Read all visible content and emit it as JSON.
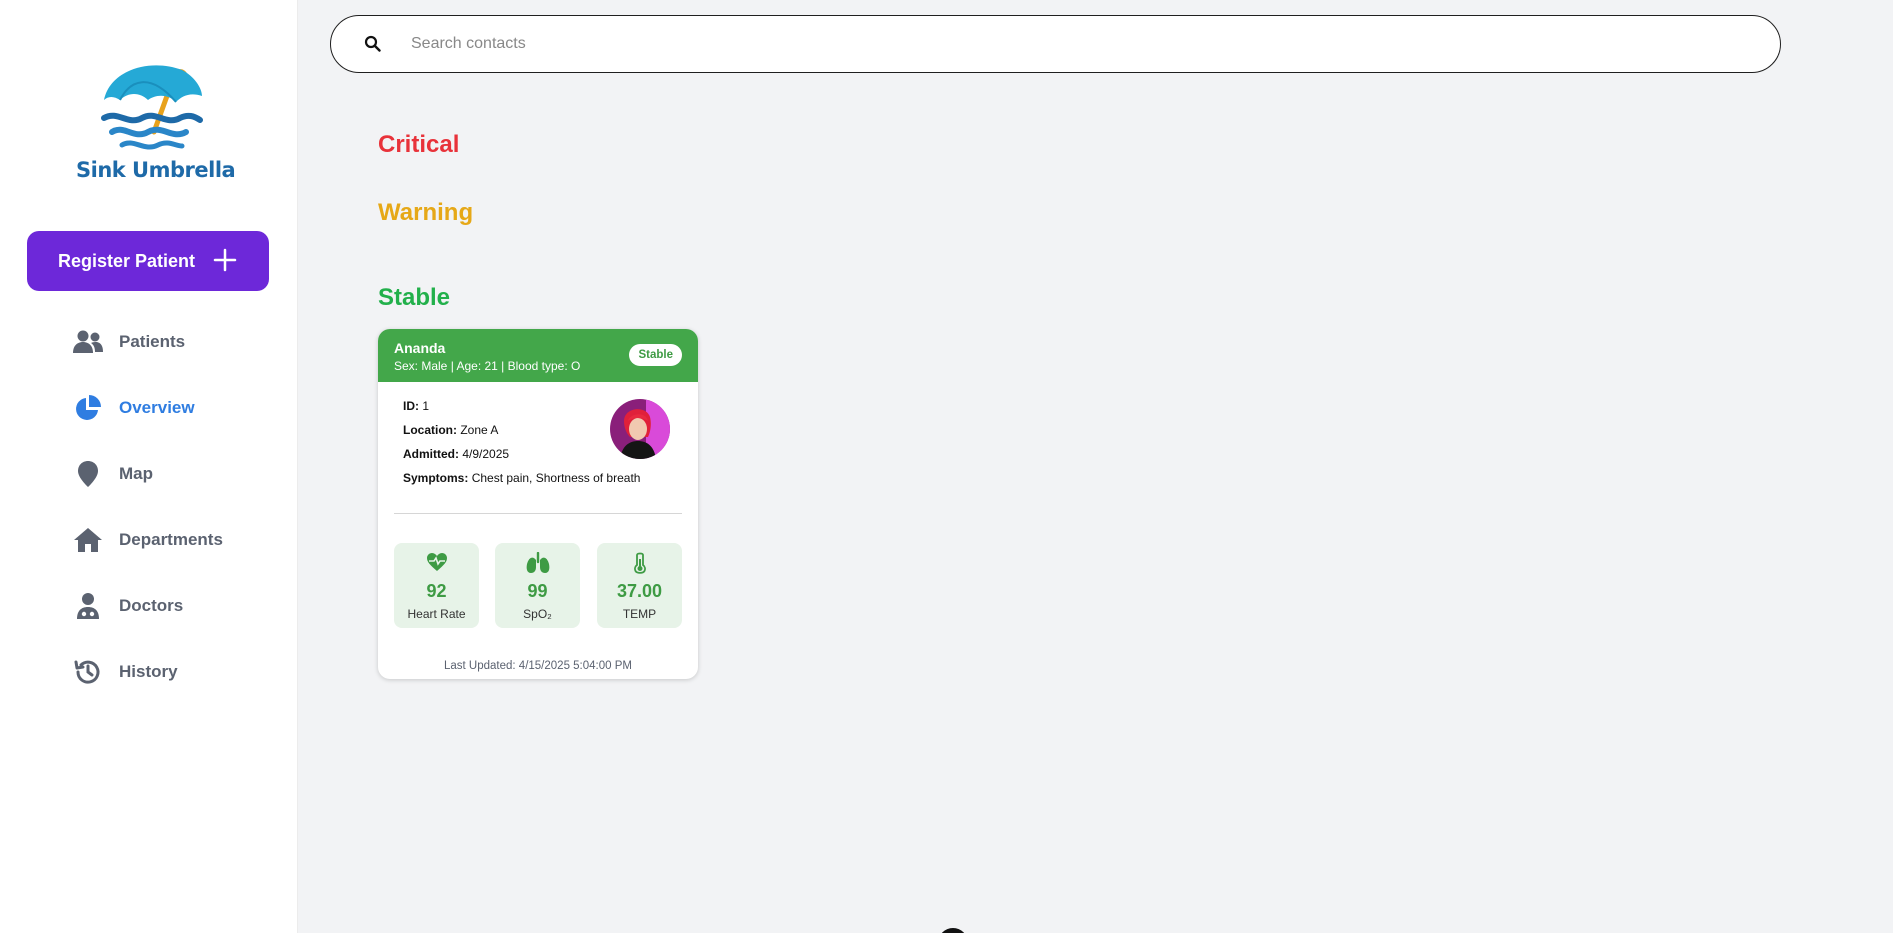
{
  "brand": {
    "name": "Sink Umbrella",
    "logo_icon": "umbrella-waves-icon"
  },
  "sidebar": {
    "register_label": "Register Patient",
    "items": [
      {
        "label": "Patients",
        "icon": "users-icon",
        "active": false
      },
      {
        "label": "Overview",
        "icon": "pie-chart-icon",
        "active": true
      },
      {
        "label": "Map",
        "icon": "map-pin-icon",
        "active": false
      },
      {
        "label": "Departments",
        "icon": "home-icon",
        "active": false
      },
      {
        "label": "Doctors",
        "icon": "doctor-icon",
        "active": false
      },
      {
        "label": "History",
        "icon": "history-icon",
        "active": false
      }
    ]
  },
  "search": {
    "placeholder": "Search contacts",
    "value": ""
  },
  "sections": {
    "critical": "Critical",
    "warning": "Warning",
    "stable": "Stable"
  },
  "patient_card": {
    "name": "Ananda",
    "subtitle": "Sex: Male | Age: 21 | Blood type: O",
    "status": "Stable",
    "id_label": "ID:",
    "id_value": "1",
    "location_label": "Location:",
    "location_value": "Zone A",
    "admitted_label": "Admitted:",
    "admitted_value": "4/9/2025",
    "symptoms_label": "Symptoms:",
    "symptoms_value": "Chest pain, Shortness of breath",
    "vitals": [
      {
        "value": "92",
        "label": "Heart Rate",
        "icon": "heart-pulse-icon"
      },
      {
        "value": "99",
        "label": "SpO₂",
        "icon": "lungs-icon"
      },
      {
        "value": "37.00",
        "label": "TEMP",
        "icon": "thermometer-icon"
      }
    ],
    "last_updated": "Last Updated: 4/15/2025 5:04:00 PM"
  },
  "colors": {
    "accent": "#6d28d9",
    "active_nav": "#2f7de1",
    "critical": "#e8323a",
    "warning": "#e6a817",
    "stable": "#22b04b",
    "card_header": "#43a74a"
  }
}
